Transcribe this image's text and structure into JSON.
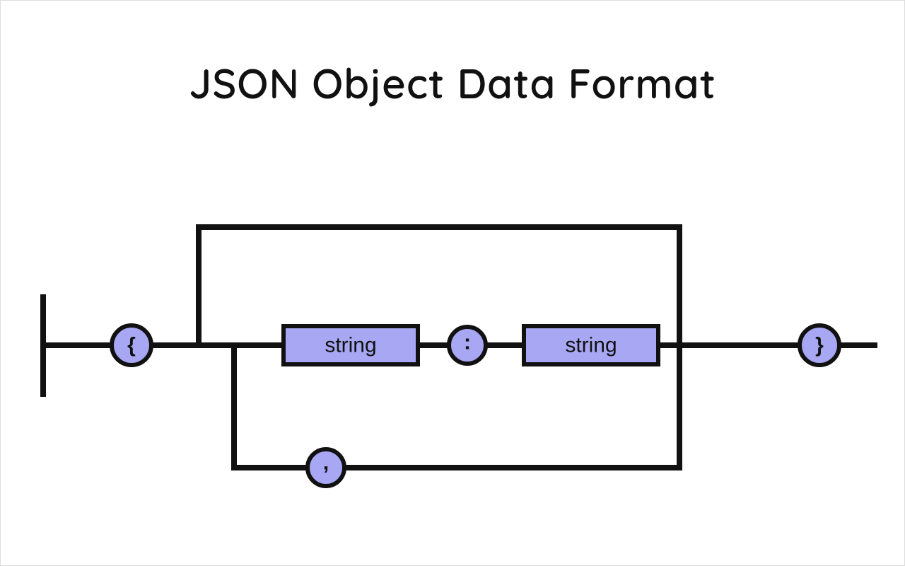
{
  "title": "JSON Object Data Format",
  "nodes": {
    "open_brace": "{",
    "close_brace": "}",
    "key_box": "string",
    "value_box": "string",
    "colon": ":",
    "comma": ","
  }
}
